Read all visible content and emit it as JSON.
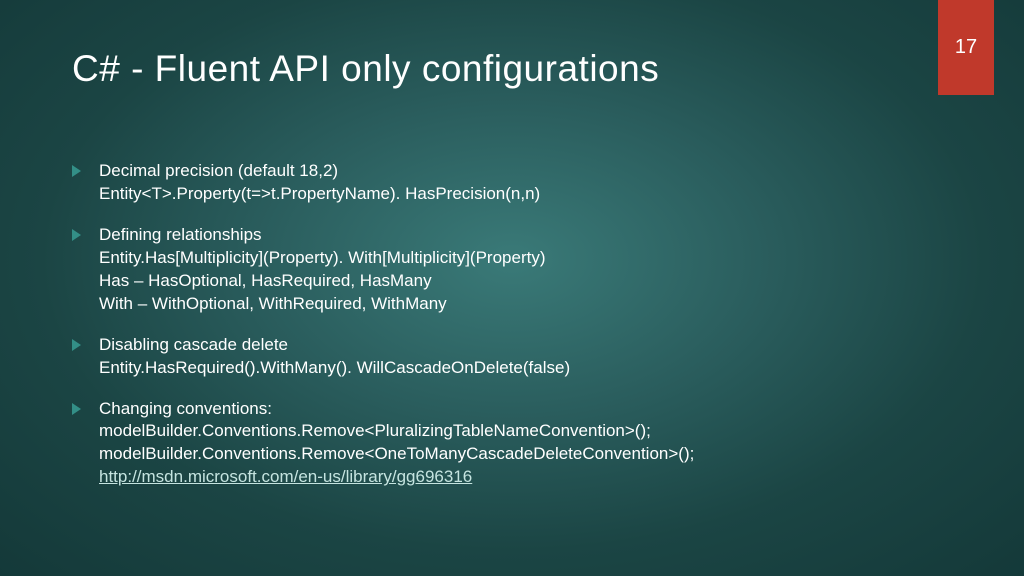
{
  "pageNumber": "17",
  "title": "C# - Fluent API only configurations",
  "bullets": [
    {
      "lines": [
        "Decimal precision (default 18,2)",
        "Entity<T>.Property(t=>t.PropertyName). HasPrecision(n,n)"
      ]
    },
    {
      "lines": [
        "Defining relationships",
        "Entity.Has[Multiplicity](Property). With[Multiplicity](Property)",
        "Has – HasOptional, HasRequired, HasMany",
        "With – WithOptional, WithRequired, WithMany"
      ]
    },
    {
      "lines": [
        "Disabling cascade delete",
        "Entity.HasRequired().WithMany(). WillCascadeOnDelete(false)"
      ]
    },
    {
      "lines": [
        "Changing conventions:",
        "modelBuilder.Conventions.Remove<PluralizingTableNameConvention>();",
        "modelBuilder.Conventions.Remove<OneToManyCascadeDeleteConvention>();"
      ],
      "link": "http://msdn.microsoft.com/en-us/library/gg696316"
    }
  ]
}
